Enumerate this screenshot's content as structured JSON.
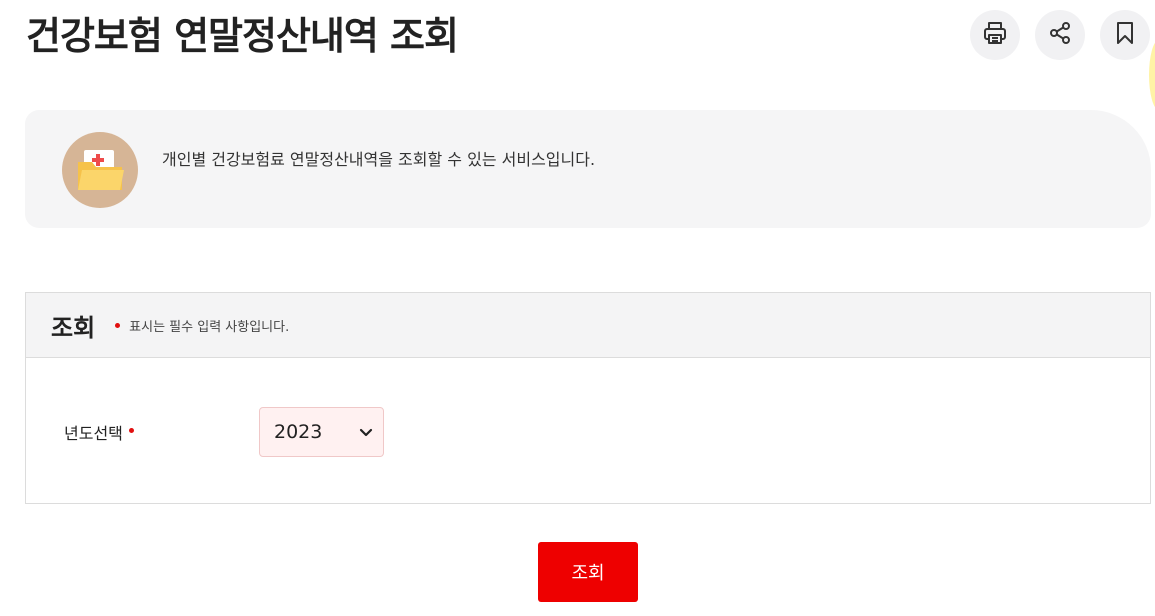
{
  "header": {
    "title": "건강보험 연말정산내역 조회",
    "tools": [
      {
        "icon": "print-icon"
      },
      {
        "icon": "share-icon"
      },
      {
        "icon": "bookmark-icon"
      }
    ]
  },
  "intro": {
    "icon": "medical-folder-icon",
    "text": "개인별 건강보험료 연말정산내역을 조회할 수 있는 서비스입니다."
  },
  "search": {
    "title": "조회",
    "required_note": "표시는 필수 입력 사항입니다.",
    "year_label": "년도선택",
    "year_selected": "2023"
  },
  "submit_label": "조회",
  "colors": {
    "accent": "#ee0000",
    "panel_bg": "#f4f4f5",
    "select_bg": "#fff1f1"
  }
}
